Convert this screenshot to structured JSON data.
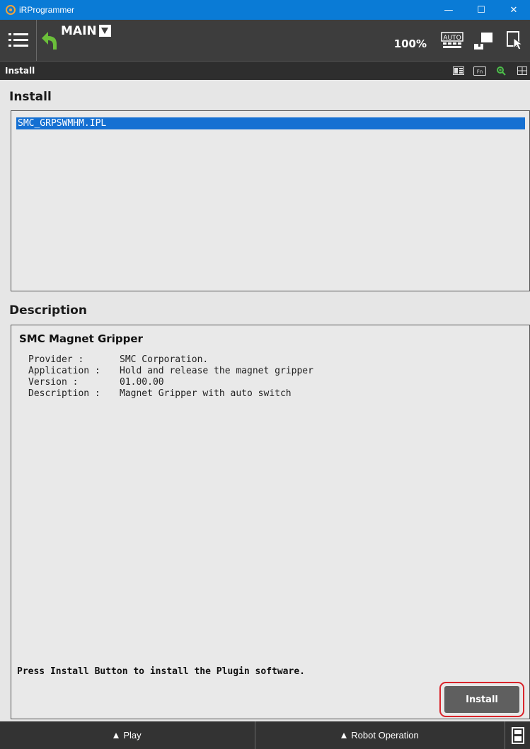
{
  "window": {
    "title": "iRProgrammer",
    "controls": [
      "—",
      "☐",
      "✕"
    ]
  },
  "toolbar": {
    "program_name": "MAIN",
    "speed_override": "100%",
    "icons": [
      "menu-icon",
      "back-arrow-icon",
      "auto-mode-icon",
      "teach-pendant-icon",
      "touch-select-icon"
    ],
    "accent_back": "#6bbf3a"
  },
  "screen": {
    "title": "Install",
    "header_icons": [
      "display-layout-icon",
      "fn-key-icon",
      "zoom-icon",
      "split-window-icon"
    ]
  },
  "install_section": {
    "heading": "Install",
    "files": [
      "SMC_GRPSWMHM.IPL"
    ],
    "selected_index": 0
  },
  "description_section": {
    "heading": "Description",
    "plugin_name": "SMC Magnet Gripper",
    "fields": [
      {
        "label": "Provider :",
        "value": "SMC Corporation."
      },
      {
        "label": "Application :",
        "value": "Hold and release the magnet gripper"
      },
      {
        "label": "Version :",
        "value": "01.00.00"
      },
      {
        "label": "Description :",
        "value": "Magnet Gripper with auto switch"
      }
    ],
    "hint": "Press Install Button to install the Plugin software.",
    "install_button": "Install"
  },
  "footer": {
    "play_label": "Play",
    "robot_operation_label": "Robot Operation",
    "last_icon": "keyboard-panel-icon"
  },
  "colors": {
    "titlebar": "#0a7bd6",
    "selection": "#1570d2",
    "highlight_border": "#d9242b"
  }
}
